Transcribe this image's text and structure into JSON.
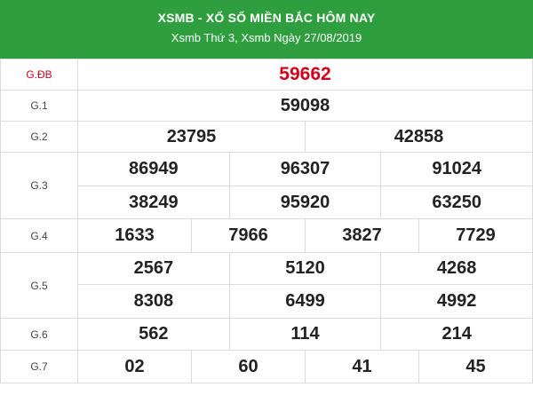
{
  "header": {
    "title": "XSMB - XỔ SỐ MIỀN BẮC HÔM NAY",
    "subtitle": "Xsmb Thứ 3, Xsmb Ngày 27/08/2019"
  },
  "prizes": {
    "db": {
      "label": "G.ĐB",
      "values": [
        "59662"
      ]
    },
    "g1": {
      "label": "G.1",
      "values": [
        "59098"
      ]
    },
    "g2": {
      "label": "G.2",
      "values": [
        "23795",
        "42858"
      ]
    },
    "g3": {
      "label": "G.3",
      "values": [
        "86949",
        "96307",
        "91024",
        "38249",
        "95920",
        "63250"
      ]
    },
    "g4": {
      "label": "G.4",
      "values": [
        "1633",
        "7966",
        "3827",
        "7729"
      ]
    },
    "g5": {
      "label": "G.5",
      "values": [
        "2567",
        "5120",
        "4268",
        "8308",
        "6499",
        "4992"
      ]
    },
    "g6": {
      "label": "G.6",
      "values": [
        "562",
        "114",
        "214"
      ]
    },
    "g7": {
      "label": "G.7",
      "values": [
        "02",
        "60",
        "41",
        "45"
      ]
    }
  },
  "colors": {
    "header_bg": "#2f9e3f",
    "special_prize": "#d0021b",
    "grid": "#dcdcdc"
  }
}
